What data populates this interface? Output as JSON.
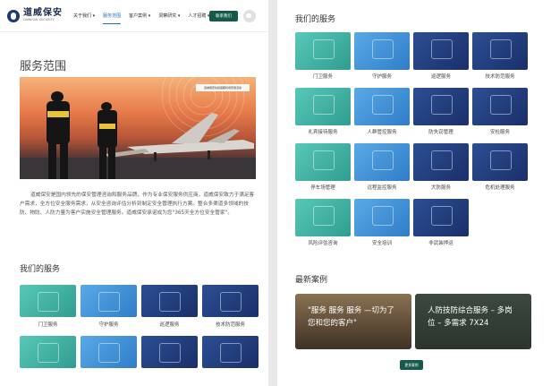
{
  "header": {
    "logo_cn": "道威保安",
    "logo_en": "DAWEIAN SECURITY",
    "nav": [
      {
        "label": "关于我们 ▾",
        "active": false
      },
      {
        "label": "服务范围",
        "active": true
      },
      {
        "label": "客户案例 ▾",
        "active": false
      },
      {
        "label": "洞察研究 ▾",
        "active": false
      },
      {
        "label": "人才招聘 ▾",
        "active": false
      }
    ],
    "contact_label": "联系我们"
  },
  "page_title": "服务范围",
  "hero": {
    "caption": "道威保安执勤首都机场安保活动"
  },
  "intro_text": "道威保安是国内领先的保安管理咨询和服务品牌，作为专业保安服务供应商，道威保安致力于满足客户需求，全方位安全服务需求，从安全咨询评估分析到制定安全管理执行方案。整合多渠道多领域的技防、物防、人防力量为客户实施安全管理服务。道威保安承诺成为您\"365天全方位安全管家\"。",
  "services_title": "我们的服务",
  "services": [
    {
      "label": "门卫服务",
      "color": "teal"
    },
    {
      "label": "守护服务",
      "color": "blue"
    },
    {
      "label": "巡逻服务",
      "color": "navy"
    },
    {
      "label": "技术防范服务",
      "color": "navy"
    },
    {
      "label": "礼宾接待服务",
      "color": "teal"
    },
    {
      "label": "人群管控服务",
      "color": "blue"
    },
    {
      "label": "防失窃管理",
      "color": "navy"
    },
    {
      "label": "安检服务",
      "color": "navy"
    },
    {
      "label": "停车场管理",
      "color": "teal"
    },
    {
      "label": "远程监控服务",
      "color": "blue"
    },
    {
      "label": "犬防服务",
      "color": "navy"
    },
    {
      "label": "危机处理服务",
      "color": "navy"
    },
    {
      "label": "风险评估咨询",
      "color": "teal"
    },
    {
      "label": "安全培训",
      "color": "blue"
    },
    {
      "label": "非武装押运",
      "color": "navy"
    }
  ],
  "cases_title": "最新案例",
  "cases": [
    {
      "text": "\"服务 服务 服务 —切为了您和您的客户\""
    },
    {
      "text": "人防技防综合服务 – 多岗位 – 多需求 7X24"
    }
  ],
  "more_label": "更多案例"
}
